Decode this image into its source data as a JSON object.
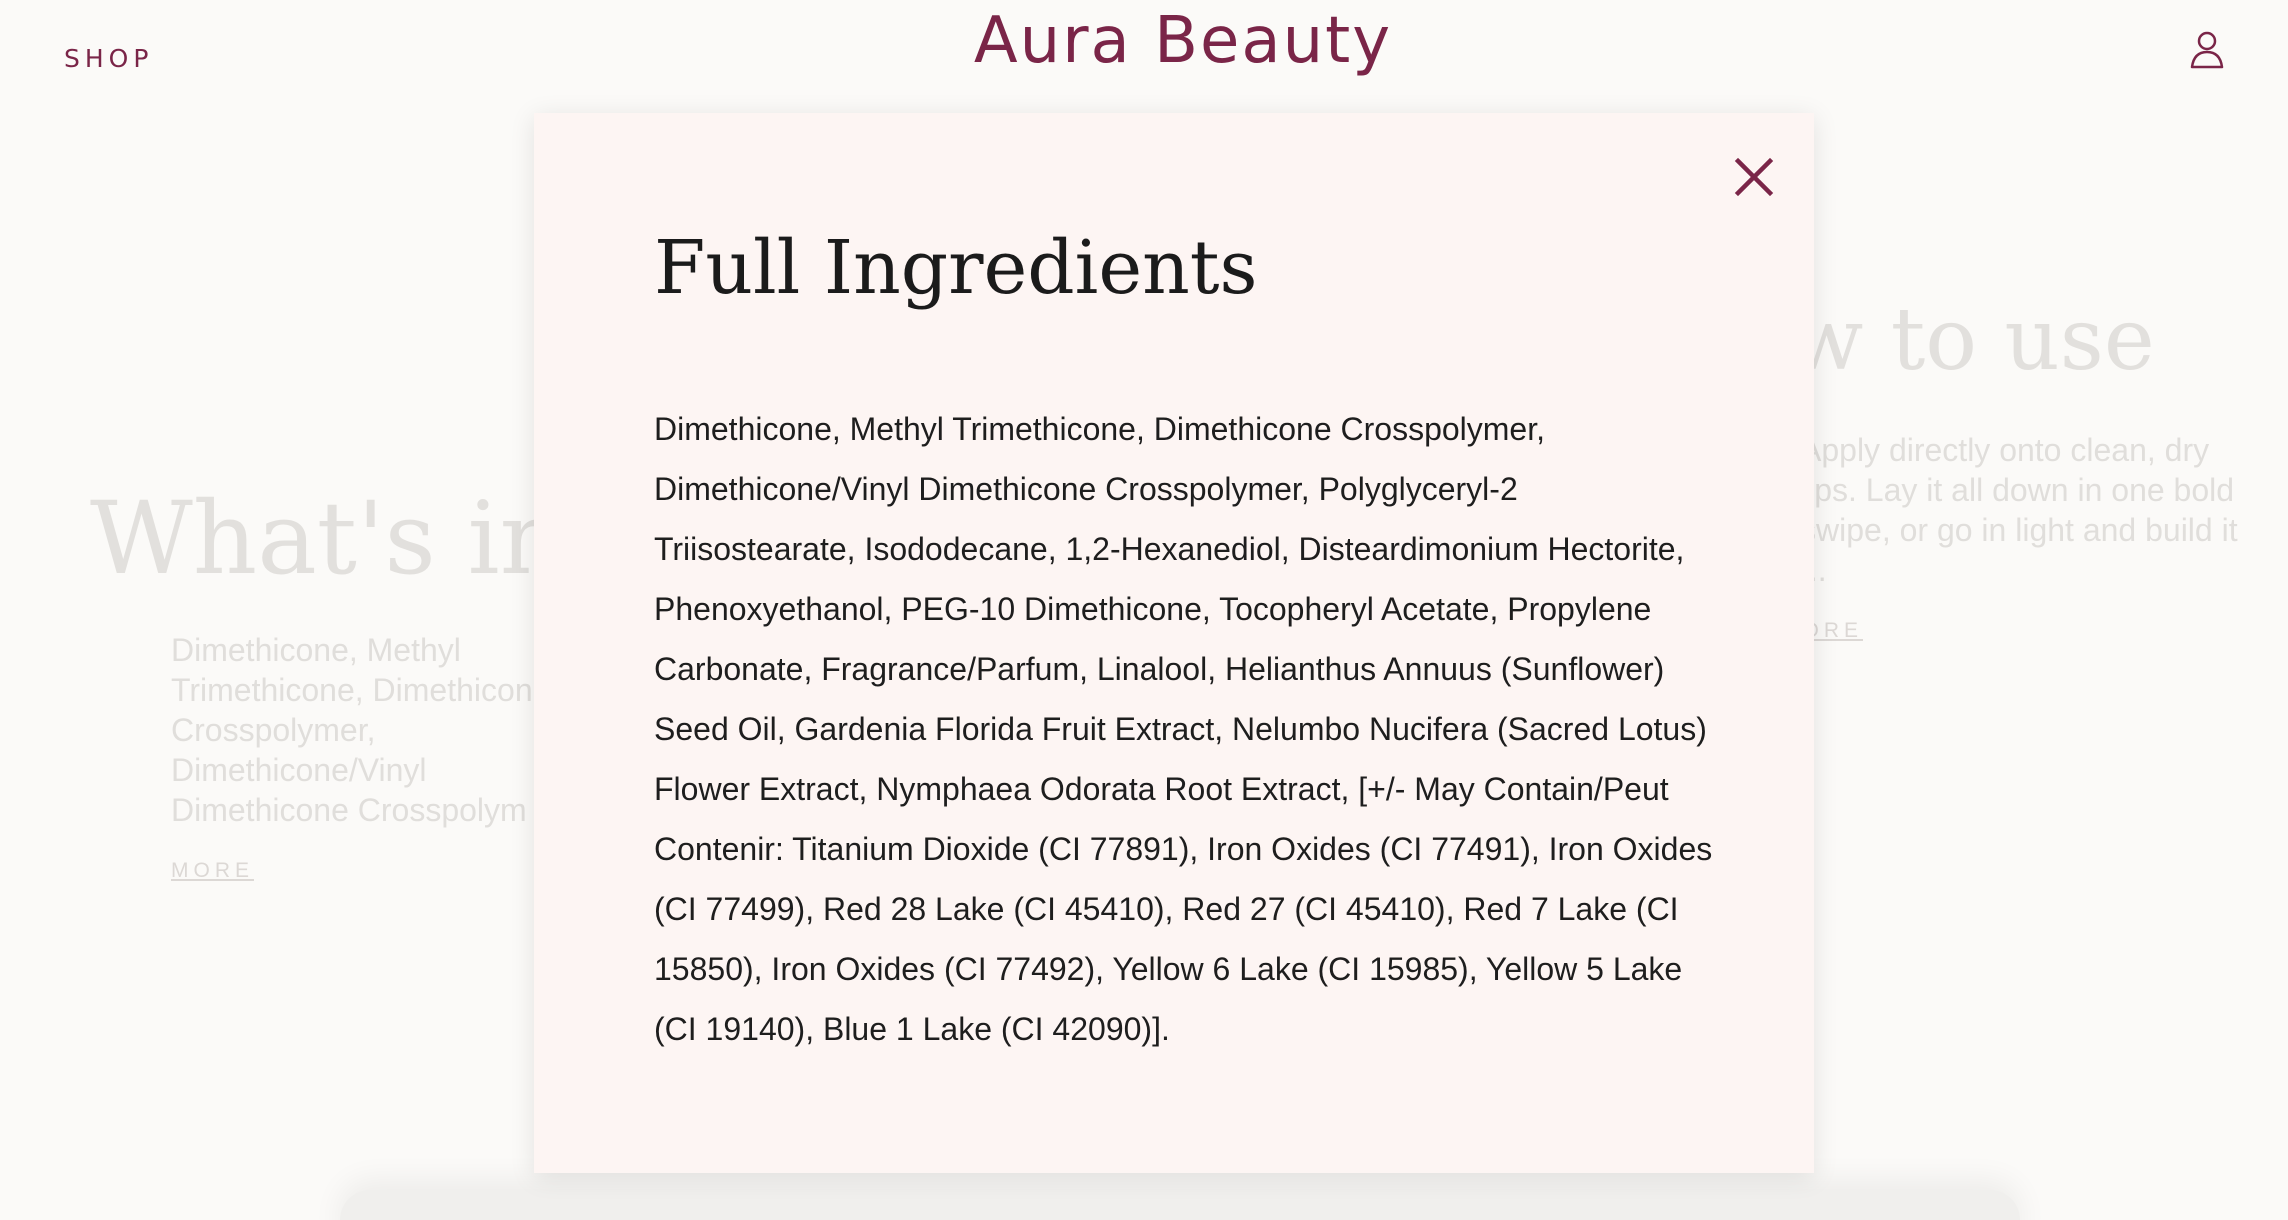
{
  "header": {
    "shop_label": "SHOP",
    "brand_name": "Aura Beauty",
    "account_icon": "user-icon"
  },
  "background": {
    "left_heading": "What's in i",
    "left_text": "Dimethicone, Methyl Trimethicone, Dimethicone Crosspolymer, Dimethicone/Vinyl Dimethicone Crosspolym",
    "left_more": "MORE",
    "right_heading": "ow to use",
    "right_text": "Apply directly onto clean, dry lips. Lay it all down in one bold swipe, or go in light and build it ...",
    "right_more": "MORE"
  },
  "modal": {
    "title": "Full Ingredients",
    "close_icon": "close-icon",
    "ingredients": "Dimethicone, Methyl Trimethicone, Dimethicone Crosspolymer, Dimethicone/Vinyl Dimethicone Crosspolymer, Polyglyceryl-2 Triisostearate, Isododecane, 1,2-Hexanediol, Disteardimonium Hectorite, Phenoxyethanol, PEG-10 Dimethicone, Tocopheryl Acetate, Propylene Carbonate, Fragrance/Parfum, Linalool, Helianthus Annuus (Sunflower) Seed Oil, Gardenia Florida Fruit Extract, Nelumbo Nucifera (Sacred Lotus) Flower Extract, Nymphaea Odorata Root Extract, [+/- May Contain/Peut Contenir: Titanium Dioxide (CI 77891), Iron Oxides (CI 77491), Iron Oxides (CI 77499), Red 28 Lake (CI 45410), Red 27 (CI 45410), Red 7 Lake (CI 15850), Iron Oxides (CI 77492), Yellow 6 Lake (CI 15985), Yellow 5 Lake (CI 19140), Blue 1 Lake (CI 42090)]."
  },
  "colors": {
    "brand": "#7a2548",
    "modal_bg": "#fdf5f3",
    "page_bg": "#fbfaf8"
  }
}
